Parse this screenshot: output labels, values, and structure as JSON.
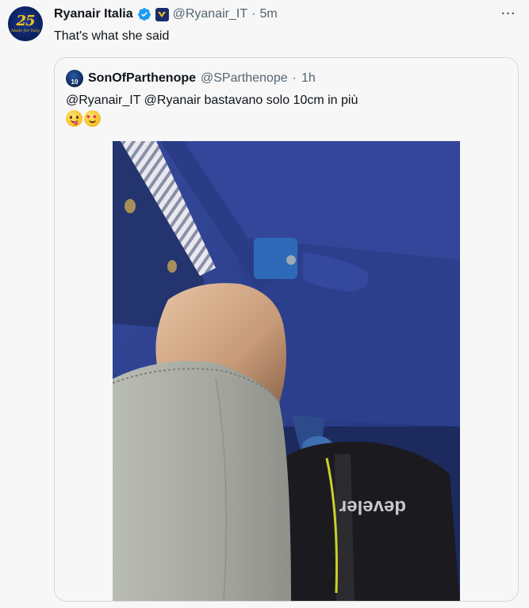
{
  "tweet": {
    "avatar_text": "25",
    "avatar_subtext": "Made for Italy",
    "display_name": "Ryanair Italia",
    "handle": "@Ryanair_IT",
    "separator": "·",
    "time": "5m",
    "more_label": "···",
    "text": "That's what she said"
  },
  "quote": {
    "avatar_text": "10",
    "display_name": "SonOfParthenope",
    "handle": "@SParthenope",
    "separator": "·",
    "time": "1h",
    "text": "@Ryanair_IT @Ryanair bastavano solo 10cm in più",
    "emojis": [
      "face-with-tongue-icon",
      "smiling-face-with-heart-eyes-icon"
    ],
    "photo": {
      "bag_brand": "develer"
    }
  },
  "colors": {
    "verified_blue": "#1d9bf0",
    "muted_text": "#536471",
    "border": "#cfd9de",
    "seat_blue": "#2a3d86"
  }
}
